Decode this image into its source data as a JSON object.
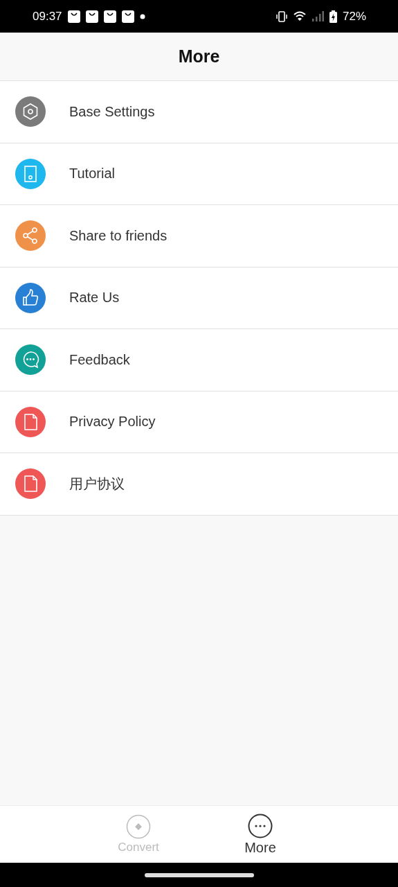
{
  "status_bar": {
    "time": "09:37",
    "battery": "72%"
  },
  "header": {
    "title": "More"
  },
  "items": [
    {
      "label": "Base Settings",
      "kind": "hexagon",
      "color": "#7b7b7b"
    },
    {
      "label": "Tutorial",
      "kind": "device",
      "color": "#1eb7ee"
    },
    {
      "label": "Share to friends",
      "kind": "share",
      "color": "#f0914a"
    },
    {
      "label": "Rate Us",
      "kind": "thumb",
      "color": "#2880d4"
    },
    {
      "label": "Feedback",
      "kind": "chat",
      "color": "#11a196"
    },
    {
      "label": "Privacy Policy",
      "kind": "document",
      "color": "#ef5656"
    },
    {
      "label": "用户协议",
      "kind": "document",
      "color": "#ef5656"
    }
  ],
  "tabs": [
    {
      "label": "Convert",
      "kind": "diamond",
      "selected": false
    },
    {
      "label": "More",
      "kind": "dots",
      "selected": true
    }
  ]
}
